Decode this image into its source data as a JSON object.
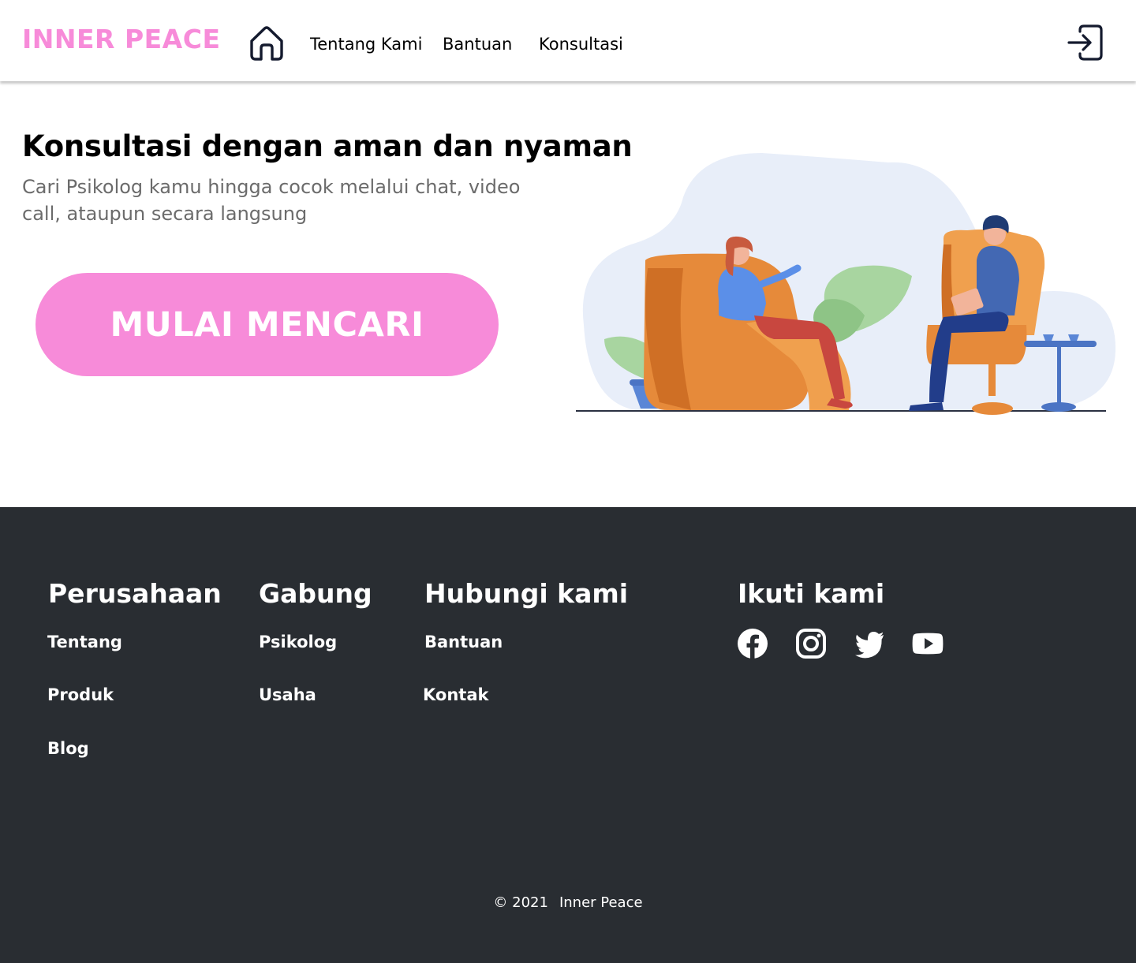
{
  "header": {
    "brand": "INNER PEACE",
    "home_icon": "home-icon",
    "nav": [
      {
        "label": "Tentang Kami"
      },
      {
        "label": "Bantuan"
      },
      {
        "label": "Konsultasi"
      }
    ],
    "login_icon": "log-in-icon"
  },
  "hero": {
    "title": "Konsultasi dengan aman dan nyaman",
    "subtitle": "Cari Psikolog kamu hingga cocok melalui chat, video call, ataupun secara langsung",
    "cta_label": "MULAI MENCARI",
    "illustration": "therapy-session-illustration"
  },
  "footer": {
    "columns": [
      {
        "title": "Perusahaan",
        "links": [
          "Tentang",
          "Produk",
          "Blog"
        ]
      },
      {
        "title": "Gabung",
        "links": [
          "Psikolog",
          "Usaha"
        ]
      },
      {
        "title": "Hubungi kami",
        "links": [
          "Bantuan",
          "Kontak"
        ]
      },
      {
        "title": "Ikuti kami",
        "links": []
      }
    ],
    "social_icons": [
      "facebook-icon",
      "instagram-icon",
      "twitter-icon",
      "youtube-icon"
    ],
    "copyright_year": "© 2021",
    "copyright_name": "Inner Peace"
  },
  "colors": {
    "brand_pink": "#f78bd9",
    "footer_bg": "#292d32",
    "subtitle_gray": "#6b6b6b"
  }
}
